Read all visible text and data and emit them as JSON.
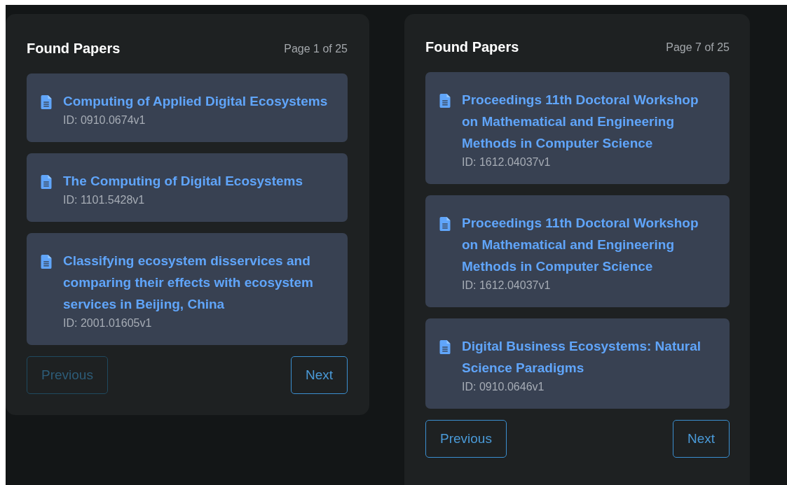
{
  "panels": [
    {
      "title": "Found Papers",
      "page_info": "Page 1 of 25",
      "papers": [
        {
          "title": "Computing of Applied Digital Ecosystems",
          "id": "ID: 0910.0674v1"
        },
        {
          "title": "The Computing of Digital Ecosystems",
          "id": "ID: 1101.5428v1"
        },
        {
          "title": "Classifying ecosystem disservices and comparing their effects with ecosystem services in Beijing, China",
          "id": "ID: 2001.01605v1"
        }
      ],
      "buttons": [
        {
          "label": "Previous",
          "disabled": true
        },
        {
          "label": "Next",
          "disabled": false
        }
      ]
    },
    {
      "title": "Found Papers",
      "page_info": "Page 7 of 25",
      "papers": [
        {
          "title": "Proceedings 11th Doctoral Workshop on Mathematical and Engineering Methods in Computer Science",
          "id": "ID: 1612.04037v1"
        },
        {
          "title": "Proceedings 11th Doctoral Workshop on Mathematical and Engineering Methods in Computer Science",
          "id": "ID: 1612.04037v1"
        },
        {
          "title": "Digital Business Ecosystems: Natural Science Paradigms",
          "id": "ID: 0910.0646v1"
        }
      ],
      "buttons": [
        {
          "label": "Previous",
          "disabled": false
        },
        {
          "label": "Next",
          "disabled": false
        }
      ]
    }
  ]
}
